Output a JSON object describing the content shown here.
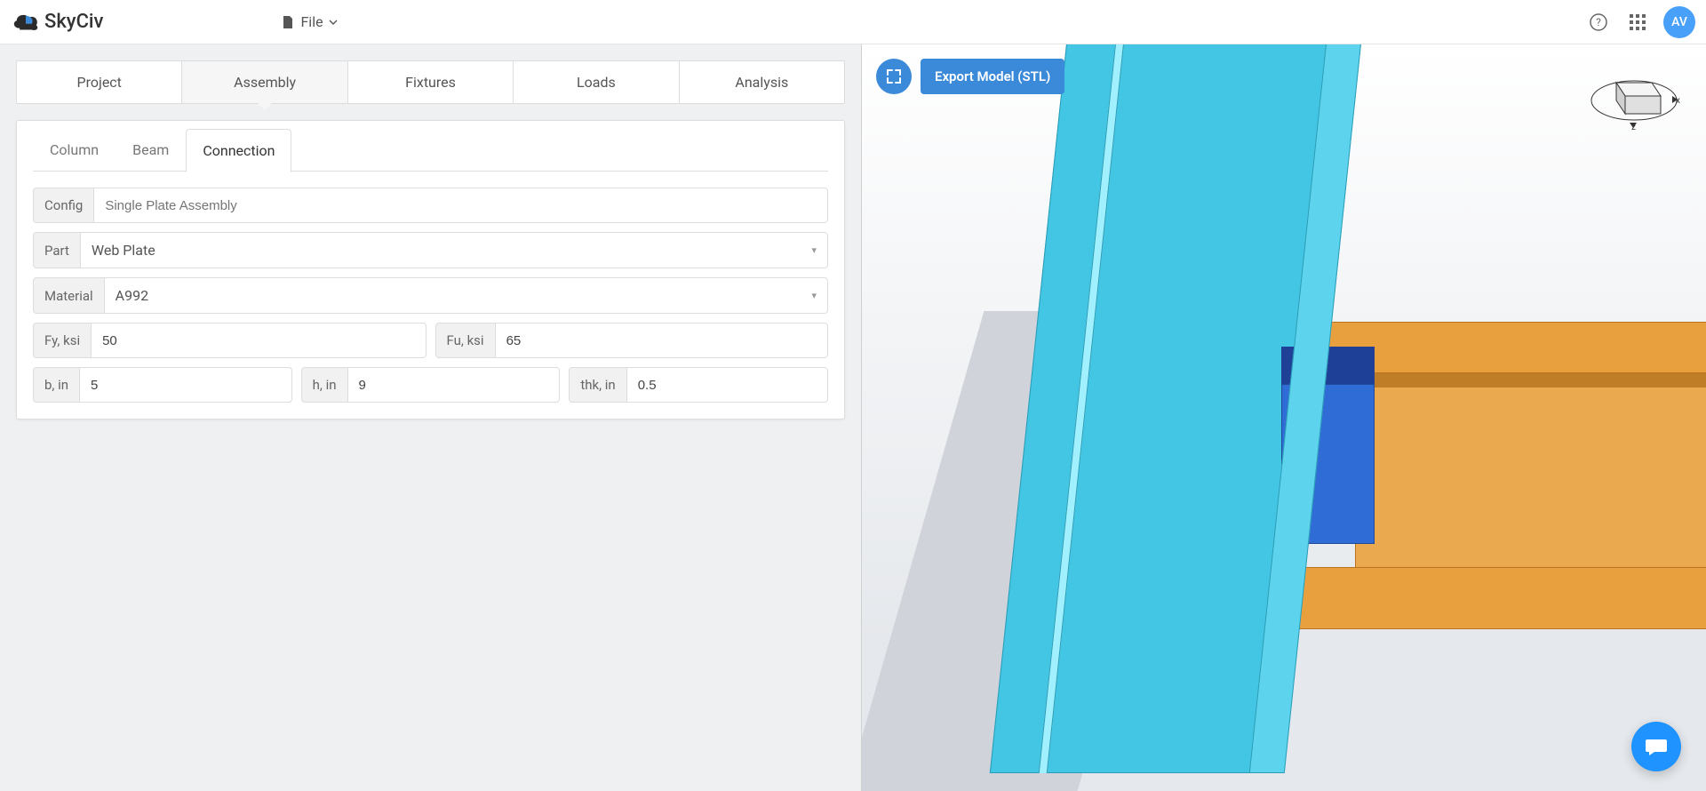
{
  "brand": "SkyCiv",
  "menu": {
    "file": "File"
  },
  "avatar": "AV",
  "main_tabs": [
    "Project",
    "Assembly",
    "Fixtures",
    "Loads",
    "Analysis"
  ],
  "main_tab_active": 1,
  "sub_tabs": [
    "Column",
    "Beam",
    "Connection"
  ],
  "sub_tab_active": 2,
  "form": {
    "config": {
      "label": "Config",
      "value": "Single Plate Assembly"
    },
    "part": {
      "label": "Part",
      "value": "Web Plate"
    },
    "material": {
      "label": "Material",
      "value": "A992"
    },
    "fy": {
      "label": "Fy, ksi",
      "value": "50"
    },
    "fu": {
      "label": "Fu, ksi",
      "value": "65"
    },
    "b": {
      "label": "b, in",
      "value": "5"
    },
    "h": {
      "label": "h, in",
      "value": "9"
    },
    "thk": {
      "label": "thk, in",
      "value": "0.5"
    }
  },
  "viewport": {
    "export_btn": "Export Model (STL)"
  },
  "colors": {
    "accent": "#3b8ad9",
    "column": "#43c5e4",
    "beam": "#e89f3e",
    "plate": "#2f6cd6"
  }
}
